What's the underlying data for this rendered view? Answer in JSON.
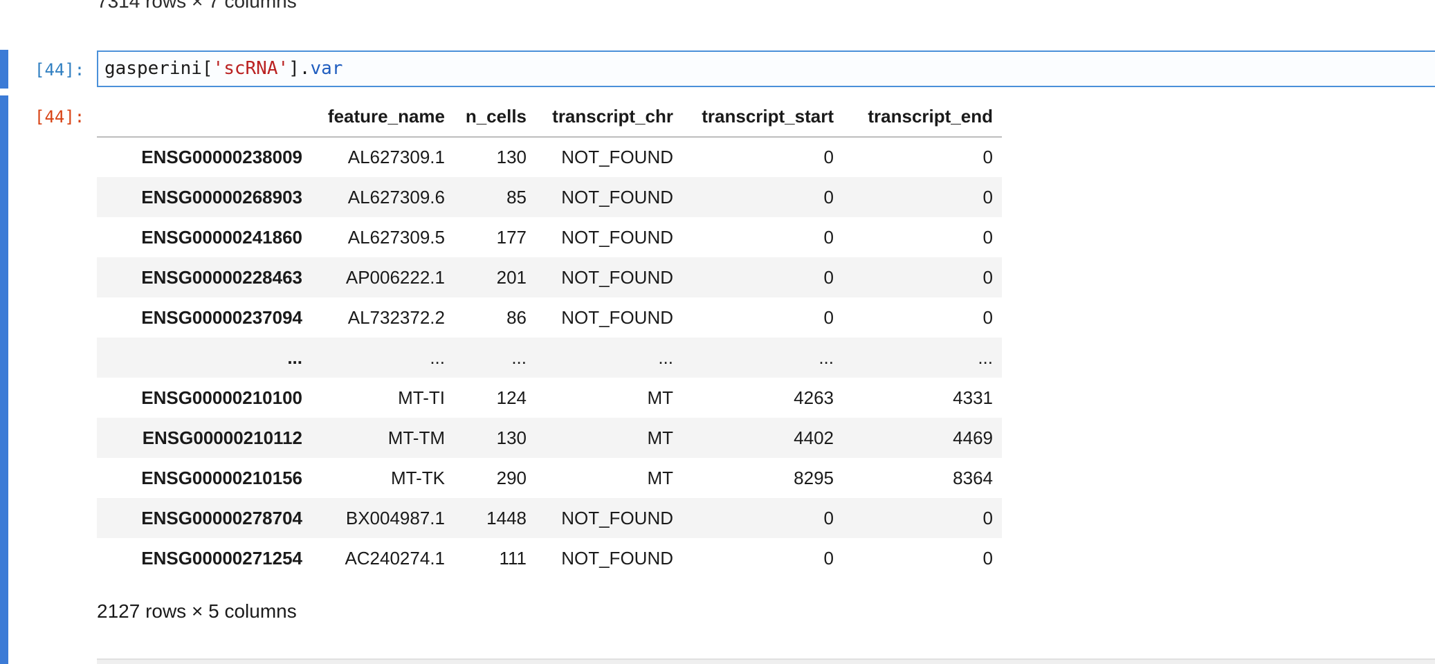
{
  "previous_output": {
    "shape_text": "7314 rows × 7 columns"
  },
  "input_cell": {
    "prompt": "[44]:",
    "code_tokens": {
      "obj": "gasperini[",
      "key": "'scRNA'",
      "close": "].",
      "attr": "var"
    }
  },
  "output_cell": {
    "prompt": "[44]:",
    "table": {
      "index_header": "",
      "columns": [
        "feature_name",
        "n_cells",
        "transcript_chr",
        "transcript_start",
        "transcript_end"
      ],
      "rows": [
        {
          "index": "ENSG00000238009",
          "cells": [
            "AL627309.1",
            "130",
            "NOT_FOUND",
            "0",
            "0"
          ]
        },
        {
          "index": "ENSG00000268903",
          "cells": [
            "AL627309.6",
            "85",
            "NOT_FOUND",
            "0",
            "0"
          ]
        },
        {
          "index": "ENSG00000241860",
          "cells": [
            "AL627309.5",
            "177",
            "NOT_FOUND",
            "0",
            "0"
          ]
        },
        {
          "index": "ENSG00000228463",
          "cells": [
            "AP006222.1",
            "201",
            "NOT_FOUND",
            "0",
            "0"
          ]
        },
        {
          "index": "ENSG00000237094",
          "cells": [
            "AL732372.2",
            "86",
            "NOT_FOUND",
            "0",
            "0"
          ]
        },
        {
          "index": "...",
          "cells": [
            "...",
            "...",
            "...",
            "...",
            "..."
          ]
        },
        {
          "index": "ENSG00000210100",
          "cells": [
            "MT-TI",
            "124",
            "MT",
            "4263",
            "4331"
          ]
        },
        {
          "index": "ENSG00000210112",
          "cells": [
            "MT-TM",
            "130",
            "MT",
            "4402",
            "4469"
          ]
        },
        {
          "index": "ENSG00000210156",
          "cells": [
            "MT-TK",
            "290",
            "MT",
            "8295",
            "8364"
          ]
        },
        {
          "index": "ENSG00000278704",
          "cells": [
            "BX004987.1",
            "1448",
            "NOT_FOUND",
            "0",
            "0"
          ]
        },
        {
          "index": "ENSG00000271254",
          "cells": [
            "AC240274.1",
            "111",
            "NOT_FOUND",
            "0",
            "0"
          ]
        }
      ]
    },
    "shape_text": "2127 rows × 5 columns"
  },
  "colors": {
    "cell_bar": "#3c7bd6",
    "prompt_in": "#307fc1",
    "prompt_out": "#d84315",
    "string_literal": "#ba2121",
    "attribute": "#1f5dbf"
  }
}
